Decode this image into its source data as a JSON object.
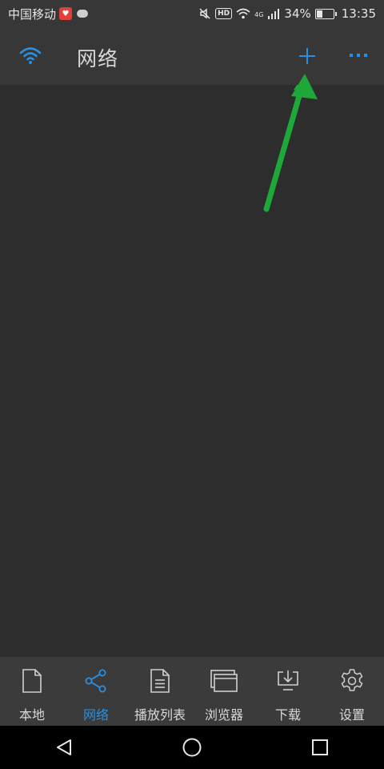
{
  "statusbar": {
    "carrier": "中国移动",
    "hd": "HD",
    "network": "4G",
    "battery_percent": "34%",
    "battery_level": 0.34,
    "time": "13:35"
  },
  "appbar": {
    "title": "网络",
    "left_icon": "wifi-icon",
    "add_icon": "plus-icon",
    "more_icon": "more-icon"
  },
  "bottom_nav": {
    "items": [
      {
        "label": "本地",
        "icon": "file-icon"
      },
      {
        "label": "网络",
        "icon": "share-icon",
        "active": true
      },
      {
        "label": "播放列表",
        "icon": "playlist-icon"
      },
      {
        "label": "浏览器",
        "icon": "browser-icon"
      },
      {
        "label": "下载",
        "icon": "download-icon"
      },
      {
        "label": "设置",
        "icon": "gear-icon"
      }
    ]
  },
  "colors": {
    "accent": "#2a8fe0",
    "annotation_arrow": "#1fa83a",
    "background": "#2d2d2d",
    "bar": "#373737"
  }
}
